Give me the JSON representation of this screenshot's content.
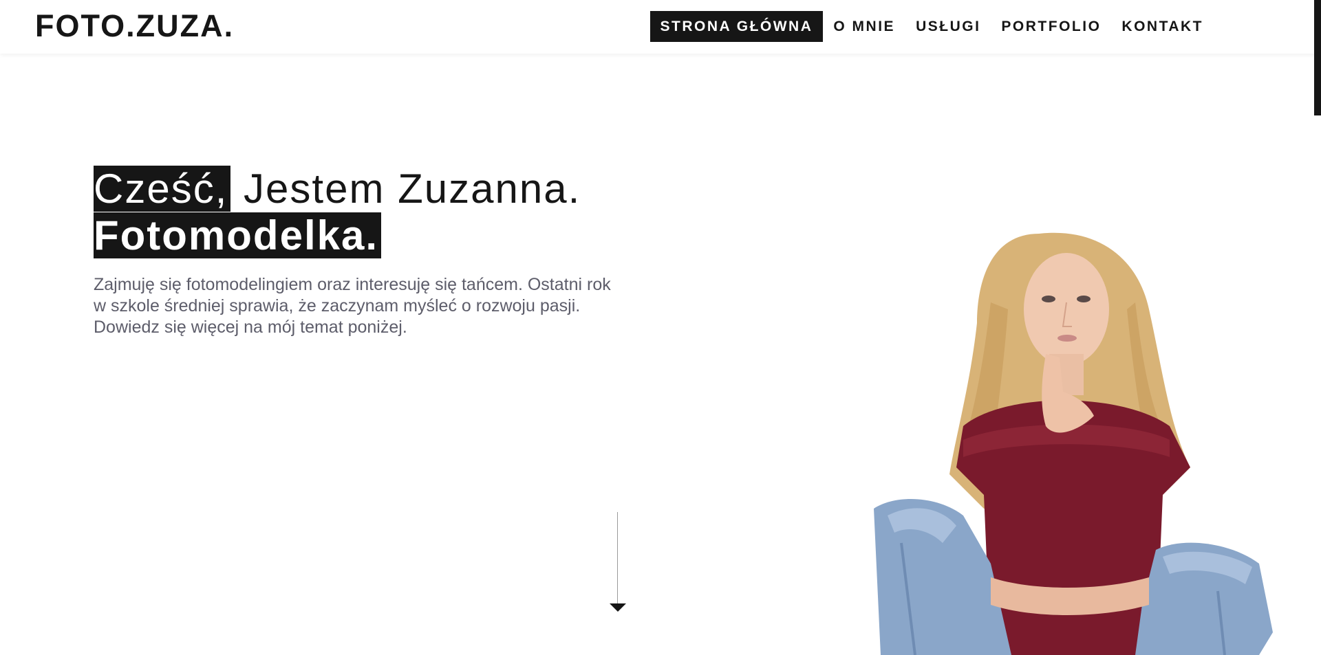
{
  "header": {
    "logo": "FOTO.ZUZA.",
    "nav": [
      "STRONA GŁÓWNA",
      "O MNIE",
      "USŁUGI",
      "PORTFOLIO",
      "KONTAKT"
    ],
    "active_index": 0
  },
  "hero": {
    "greeting": "Cześć,",
    "name_line": " Jestem Zuzanna.",
    "role": "Fotomodelka.",
    "description": "Zajmuję się fotomodelingiem oraz interesuję się tańcem. Ostatni rok w szkole średniej sprawia, że zaczynam myśleć o rozwoju pasji. Dowiedz się więcej na mój temat poniżej."
  },
  "colors": {
    "accent": "#161616",
    "text_muted": "#5d5d6a",
    "background": "#ffffff"
  },
  "icons": {
    "scroll_down": "arrow-down-icon"
  }
}
